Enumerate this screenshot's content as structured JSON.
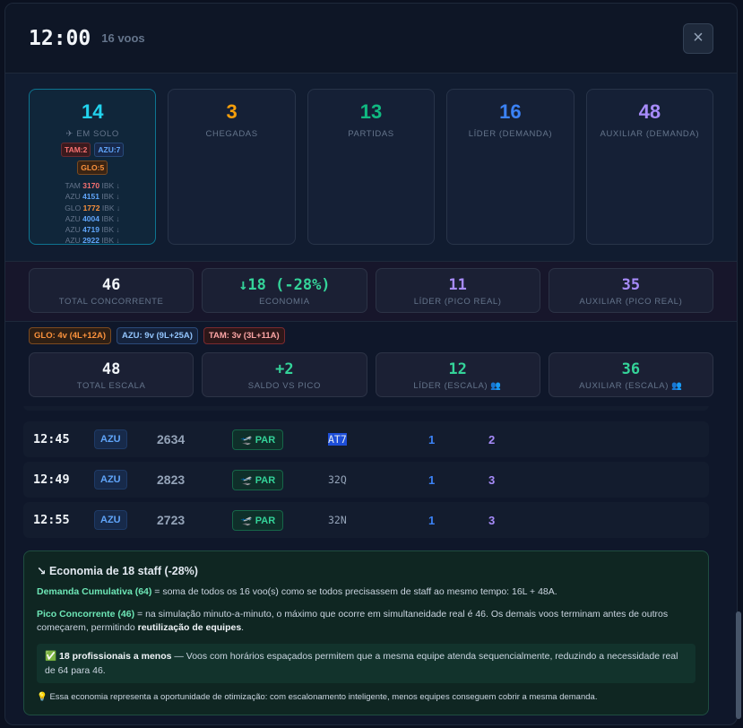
{
  "header": {
    "time": "12:00",
    "count": "16 voos",
    "close": "×"
  },
  "top_cards": [
    {
      "value": "14",
      "label": "✈ EM SOLO",
      "color": "#22d3ee"
    },
    {
      "value": "3",
      "label": "CHEGADAS",
      "color": "#f59e0b"
    },
    {
      "value": "13",
      "label": "PARTIDAS",
      "color": "#10b981"
    },
    {
      "value": "16",
      "label": "LÍDER (DEMANDA)",
      "color": "#3b82f6"
    },
    {
      "value": "48",
      "label": "AUXILIAR (DEMANDA)",
      "color": "#a78bfa"
    }
  ],
  "ground_pills": [
    "TAM:2",
    "AZU:7",
    "GLO:5"
  ],
  "ground_list": [
    {
      "air": "TAM",
      "fl": "3170",
      "tail": "IBK ↓",
      "color": "#f87171"
    },
    {
      "air": "AZU",
      "fl": "4151",
      "tail": "IBK ↓",
      "color": "#60a5fa"
    },
    {
      "air": "GLO",
      "fl": "1772",
      "tail": "IBK ↓",
      "color": "#fb923c"
    },
    {
      "air": "AZU",
      "fl": "4004",
      "tail": "IBK ↓",
      "color": "#60a5fa"
    },
    {
      "air": "AZU",
      "fl": "4719",
      "tail": "IBK ↓",
      "color": "#60a5fa"
    },
    {
      "air": "AZU",
      "fl": "2922",
      "tail": "IBK ↓",
      "color": "#60a5fa"
    }
  ],
  "mid_cards": [
    {
      "value": "46",
      "label": "TOTAL CONCORRENTE",
      "color": "#f1f5f9"
    },
    {
      "value": "↓18 (-28%)",
      "label": "ECONOMIA",
      "color": "#34d399"
    },
    {
      "value": "11",
      "label": "LÍDER (PICO REAL)",
      "color": "#a78bfa"
    },
    {
      "value": "35",
      "label": "AUXILIAR (PICO REAL)",
      "color": "#a78bfa"
    }
  ],
  "badges": [
    {
      "text": "GLO: 4v (4L+12A)",
      "fg": "#fb923c",
      "bg": "#2e1f14",
      "bd": "#7c4a20"
    },
    {
      "text": "AZU: 9v (9L+25A)",
      "fg": "#93c5fd",
      "bg": "#15233d",
      "bd": "#2b4a7a"
    },
    {
      "text": "TAM: 3v (3L+11A)",
      "fg": "#fca5a5",
      "bg": "#2d1719",
      "bd": "#7a2a30"
    }
  ],
  "scale_cards": [
    {
      "value": "48",
      "label": "TOTAL ESCALA",
      "color": "#f1f5f9"
    },
    {
      "value": "+2",
      "label": "SALDO VS PICO",
      "color": "#34d399"
    },
    {
      "value": "12",
      "label": "LÍDER (ESCALA) 👥",
      "color": "#34d399"
    },
    {
      "value": "36",
      "label": "AUXILIAR (ESCALA) 👥",
      "color": "#34d399"
    }
  ],
  "rows": [
    {
      "time": "12:45",
      "air": "AZU",
      "fl": "2634",
      "type": "🛫 PAR",
      "ac": "AT7",
      "l": "1",
      "a": "2"
    },
    {
      "time": "12:49",
      "air": "AZU",
      "fl": "2823",
      "type": "🛫 PAR",
      "ac": "32Q",
      "l": "1",
      "a": "3"
    },
    {
      "time": "12:55",
      "air": "AZU",
      "fl": "2723",
      "type": "🛫 PAR",
      "ac": "32N",
      "l": "1",
      "a": "3"
    }
  ],
  "eco": {
    "title": "↘ Economia de 18 staff (-28%)",
    "p1_b": "Demanda Cumulativa (64)",
    "p1": " = soma de todos os 16 voo(s) como se todos precisassem de staff ao mesmo tempo: 16L + 48A.",
    "p2_b": "Pico Concorrente (46)",
    "p2": " = na simulação minuto-a-minuto, o máximo que ocorre em simultaneidade real é 46. Os demais voos terminam antes de outros começarem, permitindo ",
    "p2_b2": "reutilização de equipes",
    "p2_end": ".",
    "callout_b": "✅ 18 profissionais a menos",
    "callout": " — Voos com horários espaçados permitem que a mesma equipe atenda sequencialmente, reduzindo a necessidade real de 64 para 46.",
    "tip": "💡 Essa economia representa a oportunidade de otimização: com escalonamento inteligente, menos equipes conseguem cobrir a mesma demanda."
  }
}
